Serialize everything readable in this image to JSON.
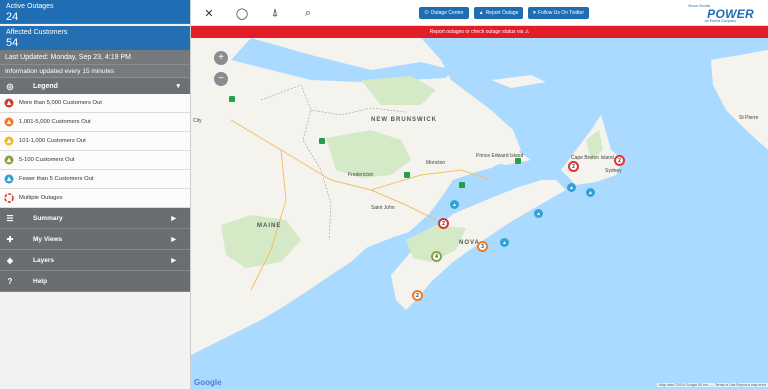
{
  "stats": {
    "active_label": "Active Outages",
    "active_value": "24",
    "affected_label": "Affected Customers",
    "affected_value": "54"
  },
  "last_updated": "Last Updated: Monday, Sep 23, 4:19 PM",
  "update_frequency": "Information updated every 15 minutes",
  "legend": {
    "title": "Legend",
    "items": [
      {
        "label": "More than 5,000 Customers Out",
        "color": "#d63a2f"
      },
      {
        "label": "1,001-5,000 Customers Out",
        "color": "#f07b22"
      },
      {
        "label": "101-1,000 Customers Out",
        "color": "#f2b81c"
      },
      {
        "label": "5-100 Customers Out",
        "color": "#8aa33a"
      },
      {
        "label": "Fewer than 5 Customers Out",
        "color": "#2fa3d6"
      },
      {
        "label": "Multiple Outages",
        "color": "#d63a2f"
      }
    ]
  },
  "nav": {
    "summary": "Summary",
    "my_views": "My Views",
    "layers": "Layers",
    "help": "Help"
  },
  "toolbar": {
    "outage_centre": "Outage Centre",
    "report_outage": "Report Outage",
    "follow_twitter": "Follow Us On Twitter"
  },
  "brand": {
    "top": "Nova Scotia",
    "main": "POWER",
    "bottom": "An Emera Company"
  },
  "alert": "Report outages or check outage status via",
  "map": {
    "labels": {
      "new_brunswick": "NEW BRUNSWICK",
      "maine": "MAINE",
      "nova_scotia": "NOVA",
      "fredericton": "Fredericton",
      "saint_john": "Saint John",
      "moncton": "Moncton",
      "pei": "Prince Edward Island",
      "cape_breton": "Cape Breton Island",
      "st_pierre": "St Pierre",
      "quebec_city": "City",
      "sydney": "Sydney"
    },
    "zoom_in": "+",
    "zoom_out": "−",
    "outages": [
      "2",
      "2",
      "2",
      "3",
      "4",
      "2",
      "2"
    ],
    "google": "Google",
    "attribution": "Map data ©2019 Google   50 km ⎯⎯⎯   Terms of Use   Report a map error"
  },
  "icons": {
    "close": "close-icon",
    "circle": "circle-tool-icon",
    "locate": "locate-icon",
    "search": "search-icon"
  }
}
